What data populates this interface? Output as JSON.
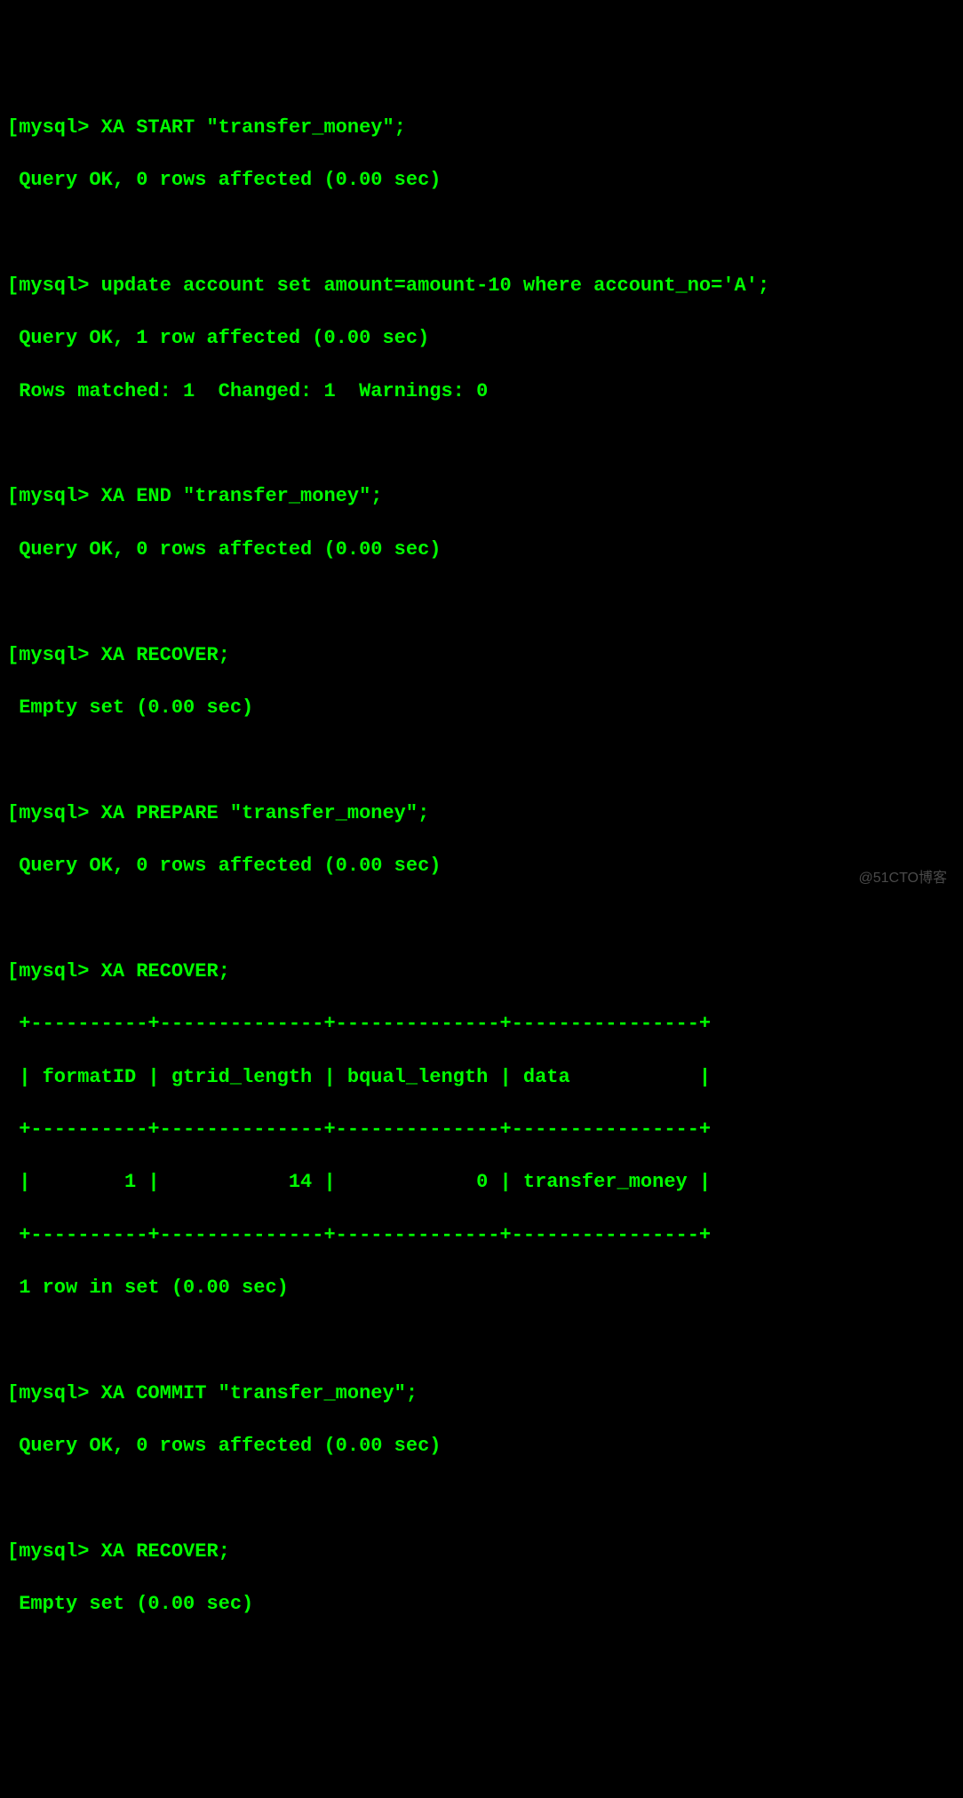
{
  "prompt": "mysql> ",
  "bracket": "[",
  "commands": {
    "cmd1": "XA START \"transfer_money\";",
    "resp1": "Query OK, 0 rows affected (0.00 sec)",
    "cmd2": "update account set amount=amount-10 where account_no='A';",
    "resp2a": "Query OK, 1 row affected (0.00 sec)",
    "resp2b": "Rows matched: 1  Changed: 1  Warnings: 0",
    "cmd3": "XA END \"transfer_money\";",
    "resp3": "Query OK, 0 rows affected (0.00 sec)",
    "cmd4": "XA RECOVER;",
    "resp4": "Empty set (0.00 sec)",
    "cmd5": "XA PREPARE \"transfer_money\";",
    "resp5": "Query OK, 0 rows affected (0.00 sec)",
    "cmd6": "XA RECOVER;",
    "table_border": "+----------+--------------+--------------+----------------+",
    "table_header": "| formatID | gtrid_length | bqual_length | data           |",
    "table_row1": "|        1 |           14 |            0 | transfer_money |",
    "resp6": "1 row in set (0.00 sec)",
    "cmd7": "XA COMMIT \"transfer_money\";",
    "resp7": "Query OK, 0 rows affected (0.00 sec)",
    "cmd8": "XA RECOVER;",
    "resp8": "Empty set (0.00 sec)"
  },
  "watermark": "@51CTO博客"
}
